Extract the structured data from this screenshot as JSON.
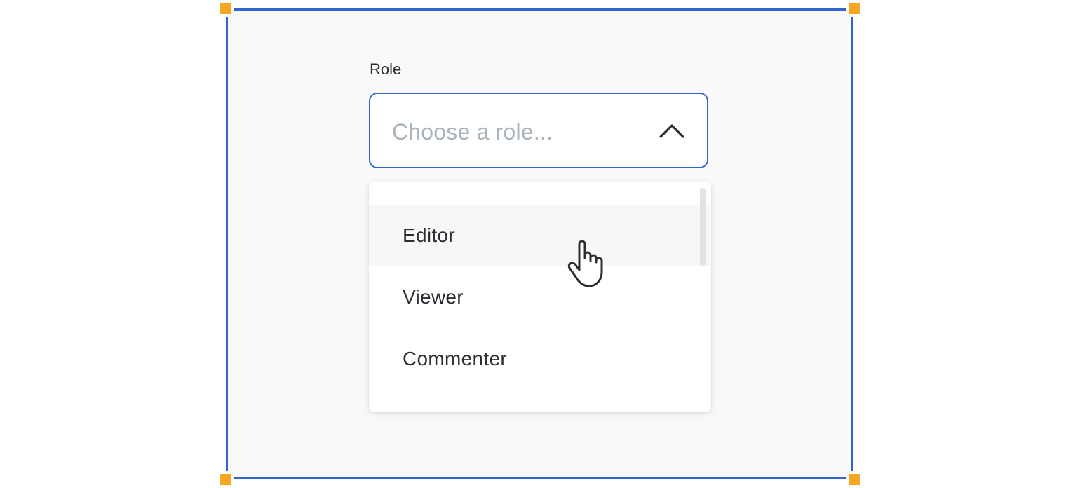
{
  "field": {
    "label": "Role",
    "placeholder": "Choose a role...",
    "state": "open"
  },
  "menu": {
    "items": [
      {
        "label": "Editor",
        "hovered": true
      },
      {
        "label": "Viewer",
        "hovered": false
      },
      {
        "label": "Commenter",
        "hovered": false
      }
    ]
  },
  "colors": {
    "accent": "#3366cc",
    "handle": "#f5a623",
    "placeholder": "#a9b4bd",
    "text": "#2b2f33",
    "canvas": "#f9f9f9"
  },
  "icons": {
    "chevron": "chevron-up-icon",
    "cursor": "hand-pointer-icon"
  }
}
